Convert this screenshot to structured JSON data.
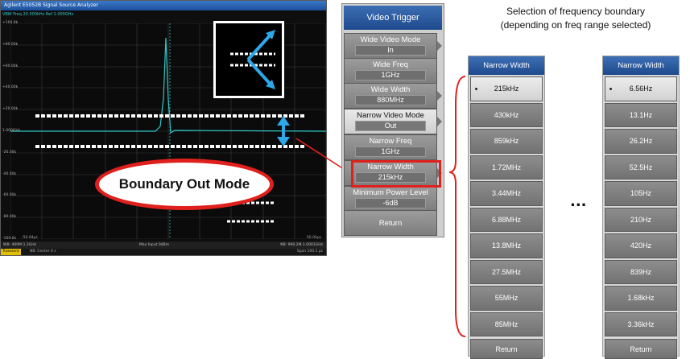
{
  "analyzer": {
    "title": "Agilent E5052B Signal Source Analyzer",
    "info": "VBW Freq 20.000kHz Ref 1.000GHz",
    "y_labels": [
      "+100.0k",
      "+80.00k",
      "+60.00k",
      "+40.00k",
      "+20.00k",
      "1.000GHz",
      "-20.00k",
      "-40.00k",
      "-60.00k",
      "-80.00k",
      "-100.0k"
    ],
    "x_start": "-50.04µs",
    "x_stop": "50.04µs",
    "status_left": "WB: 400M-1.2GHz",
    "status_mid": "Max Input 0dBm",
    "status_right": "NB: 999.2M-1.0001GHz",
    "bar_mode": "Transient",
    "bar_center": "NB: Center 0 s",
    "bar_span": "Span 100.1 µs",
    "trace_color": "#2fc8c8",
    "boundary_color": "#ffffff",
    "arrow_color": "#2ea8e8"
  },
  "callout": {
    "label": "Boundary Out Mode",
    "color": "#e0201c"
  },
  "softkeys": {
    "title": "Video Trigger",
    "items": [
      {
        "label": "Wide Video Mode",
        "value": "In"
      },
      {
        "label": "Wide Freq",
        "value": "1GHz"
      },
      {
        "label": "Wide Width",
        "value": "880MHz"
      },
      {
        "label": "Narrow Video Mode",
        "value": "Out"
      },
      {
        "label": "Narrow Freq",
        "value": "1GHz"
      },
      {
        "label": "Narrow Width",
        "value": "215kHz"
      },
      {
        "label": "Minimum Power Level",
        "value": "-6dB"
      }
    ],
    "return_label": "Return"
  },
  "header": {
    "line1": "Selection of frequency boundary",
    "line2": "(depending on freq range selected)"
  },
  "list_a": {
    "title": "Narrow Width",
    "items": [
      "215kHz",
      "430kHz",
      "859kHz",
      "1.72MHz",
      "3.44MHz",
      "6.88MHz",
      "13.8MHz",
      "27.5MHz",
      "55MHz",
      "85MHz"
    ],
    "return_label": "Return"
  },
  "list_b": {
    "title": "Narrow Width",
    "items": [
      "6.56Hz",
      "13.1Hz",
      "26.2Hz",
      "52.5Hz",
      "105Hz",
      "210Hz",
      "420Hz",
      "839Hz",
      "1.68kHz",
      "3.36kHz"
    ],
    "return_label": "Return"
  },
  "ellipsis": "..."
}
